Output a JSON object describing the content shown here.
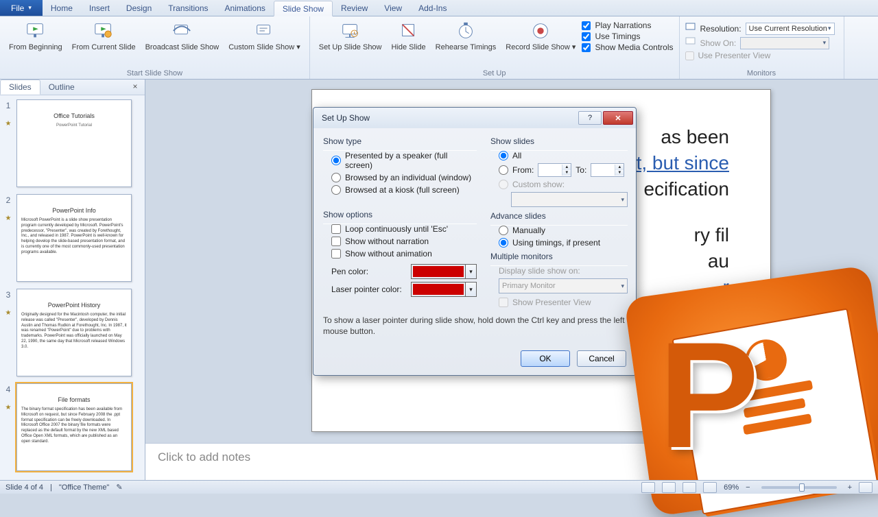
{
  "tabs": {
    "file": "File",
    "items": [
      "Home",
      "Insert",
      "Design",
      "Transitions",
      "Animations",
      "Slide Show",
      "Review",
      "View",
      "Add-Ins"
    ],
    "active": "Slide Show"
  },
  "ribbon": {
    "start": {
      "label": "Start Slide Show",
      "from_beginning": "From Beginning",
      "from_current": "From Current Slide",
      "broadcast": "Broadcast Slide Show",
      "custom": "Custom Slide Show"
    },
    "setup": {
      "label": "Set Up",
      "setup_show": "Set Up Slide Show",
      "hide": "Hide Slide",
      "rehearse": "Rehearse Timings",
      "record": "Record Slide Show",
      "play_narrations": "Play Narrations",
      "use_timings": "Use Timings",
      "show_media": "Show Media Controls"
    },
    "monitors": {
      "label": "Monitors",
      "resolution_lbl": "Resolution:",
      "resolution_val": "Use Current Resolution",
      "show_on_lbl": "Show On:",
      "show_on_val": "",
      "presenter_view": "Use Presenter View"
    }
  },
  "panel": {
    "slides_tab": "Slides",
    "outline_tab": "Outline",
    "thumbs": [
      {
        "n": "1",
        "title": "Office Tutorials",
        "subtitle": "PowerPoint Tutorial",
        "body": ""
      },
      {
        "n": "2",
        "title": "PowerPoint Info",
        "body": "Microsoft PowerPoint is a slide show presentation program currently developed by Microsoft. PowerPoint's predecessor, \"Presenter\", was created by Forethought, Inc., and released in 1987. PowerPoint is well-known for helping develop the slide-based presentation format, and is currently one of the most commonly-used presentation programs available."
      },
      {
        "n": "3",
        "title": "PowerPoint History",
        "body": "Originally designed for the Macintosh computer, the initial release was called \"Presenter\", developed by Dennis Austin and Thomas Rudkin at Forethought, Inc. In 1987, it was renamed \"PowerPoint\" due to problems with trademarks. PowerPoint was officially launched on May 22, 1990, the same day that Microsoft released Windows 3.0."
      },
      {
        "n": "4",
        "title": "File formats",
        "body": "The binary format specification has been available from Microsoft on request, but since February 2008 the .ppt format specification can be freely downloaded. In Microsoft Office 2007 the binary file formats were replaced as the default format by the new XML based Office Open XML formats, which are published as an open standard."
      }
    ],
    "selected": 3
  },
  "slide": {
    "visible_lines": [
      "as been",
      "est, but since",
      "ecification",
      "ry fil",
      "au",
      "r"
    ]
  },
  "notes_placeholder": "Click to add notes",
  "dialog": {
    "title": "Set Up Show",
    "show_type": {
      "heading": "Show type",
      "opt1": "Presented by a speaker (full screen)",
      "opt2": "Browsed by an individual (window)",
      "opt3": "Browsed at a kiosk (full screen)"
    },
    "show_options": {
      "heading": "Show options",
      "loop": "Loop continuously until 'Esc'",
      "no_narration": "Show without narration",
      "no_animation": "Show without animation",
      "pen_color": "Pen color:",
      "laser_color": "Laser pointer color:"
    },
    "show_slides": {
      "heading": "Show slides",
      "all": "All",
      "from": "From:",
      "to": "To:",
      "custom": "Custom show:"
    },
    "advance": {
      "heading": "Advance slides",
      "manually": "Manually",
      "timings": "Using timings, if present"
    },
    "multi_mon": {
      "heading": "Multiple monitors",
      "display_on": "Display slide show on:",
      "primary": "Primary Monitor",
      "presenter_view": "Show Presenter View"
    },
    "hint": "To show a laser pointer during slide show, hold down the Ctrl key and press the left mouse button.",
    "ok": "OK",
    "cancel": "Cancel"
  },
  "status": {
    "slide": "Slide 4 of 4",
    "theme": "\"Office Theme\"",
    "zoom": "69%"
  },
  "colors": {
    "pen": "#cc0000",
    "laser": "#cc0000"
  }
}
